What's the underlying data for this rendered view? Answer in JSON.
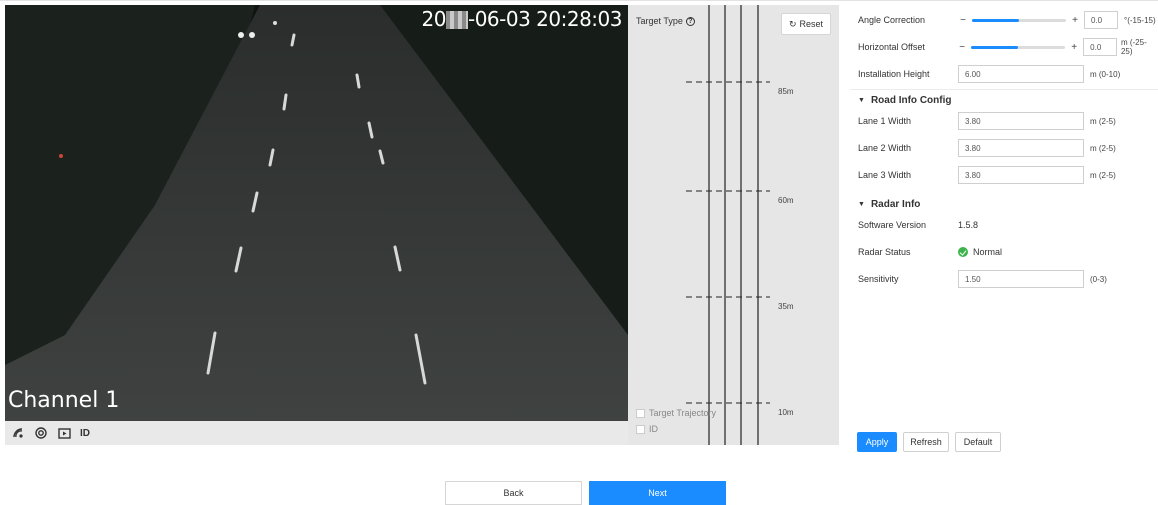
{
  "video": {
    "timestamp_prefix": "20",
    "timestamp_suffix": "-06-03 20:28:03",
    "channel": "Channel 1",
    "toolbar": {
      "icons": [
        "radar-target-icon",
        "target-ring-icon",
        "video-box-icon"
      ],
      "id_label": "ID"
    }
  },
  "radar": {
    "target_type_label": "Target Type",
    "reset_label": "Reset",
    "distances": [
      "85m",
      "60m",
      "35m",
      "10m"
    ],
    "target_trajectory_label": "Target Trajectory",
    "id_label": "ID"
  },
  "settings": {
    "angle_correction": {
      "label": "Angle Correction",
      "value": "0.0",
      "range": "°(-15-15)",
      "minus": "−",
      "plus": "+",
      "level": 0.5
    },
    "horizontal_offset": {
      "label": "Horizontal Offset",
      "value": "0.0",
      "range": "m (-25-25)",
      "minus": "−",
      "plus": "+",
      "level": 0.5
    },
    "installation_height": {
      "label": "Installation Height",
      "value": "6.00",
      "unit": "m (0-10)"
    },
    "road_info": {
      "title": "Road Info Config",
      "lanes": [
        {
          "label": "Lane 1 Width",
          "value": "3.80",
          "unit": "m (2-5)"
        },
        {
          "label": "Lane 2 Width",
          "value": "3.80",
          "unit": "m (2-5)"
        },
        {
          "label": "Lane 3 Width",
          "value": "3.80",
          "unit": "m (2-5)"
        }
      ]
    },
    "radar_info": {
      "title": "Radar Info",
      "software_version_label": "Software Version",
      "software_version": "1.5.8",
      "status_label": "Radar Status",
      "status_value": "Normal",
      "sensitivity_label": "Sensitivity",
      "sensitivity_value": "1.50",
      "sensitivity_range": "(0-3)"
    },
    "buttons": {
      "apply": "Apply",
      "refresh": "Refresh",
      "default": "Default"
    }
  },
  "footer": {
    "back": "Back",
    "next": "Next"
  },
  "colors": {
    "accent": "#1a8cff",
    "ok": "#3cb44b",
    "panel_bg": "#e6e6e6"
  }
}
